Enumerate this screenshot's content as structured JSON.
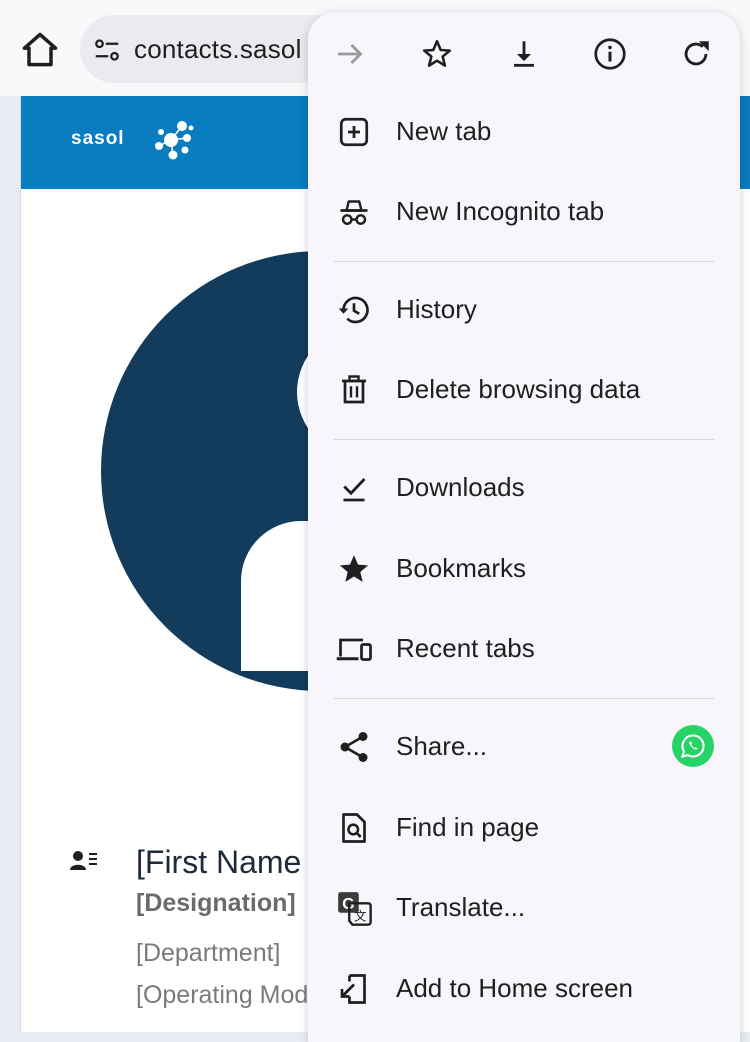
{
  "browser": {
    "url": "contacts.sasol",
    "icons": {
      "home": "home-icon",
      "site_settings": "tune-icon",
      "forward": "arrow-forward-icon",
      "bookmark": "star-outline-icon",
      "download": "download-icon",
      "info": "info-icon",
      "reload": "refresh-icon"
    }
  },
  "page": {
    "brand": "sasol",
    "name": "[First Name",
    "designation": "[Designation]",
    "department": "[Department]",
    "operating_model": "[Operating Mod",
    "colors": {
      "header": "#0a7cc0",
      "avatar": "#123b5c"
    }
  },
  "menu": {
    "items": [
      {
        "label": "New tab",
        "icon": "add-box-icon"
      },
      {
        "label": "New Incognito tab",
        "icon": "incognito-icon"
      },
      {
        "label": "History",
        "icon": "history-icon"
      },
      {
        "label": "Delete browsing data",
        "icon": "trash-icon"
      },
      {
        "label": "Downloads",
        "icon": "download-done-icon"
      },
      {
        "label": "Bookmarks",
        "icon": "star-icon"
      },
      {
        "label": "Recent tabs",
        "icon": "devices-icon"
      },
      {
        "label": "Share...",
        "icon": "share-icon"
      },
      {
        "label": "Find in page",
        "icon": "find-in-page-icon"
      },
      {
        "label": "Translate...",
        "icon": "translate-icon"
      },
      {
        "label": "Add to Home screen",
        "icon": "add-to-home-icon"
      }
    ],
    "share_target": "whatsapp-icon",
    "colors": {
      "background": "#f8f6fb",
      "whatsapp": "#25d366"
    }
  }
}
